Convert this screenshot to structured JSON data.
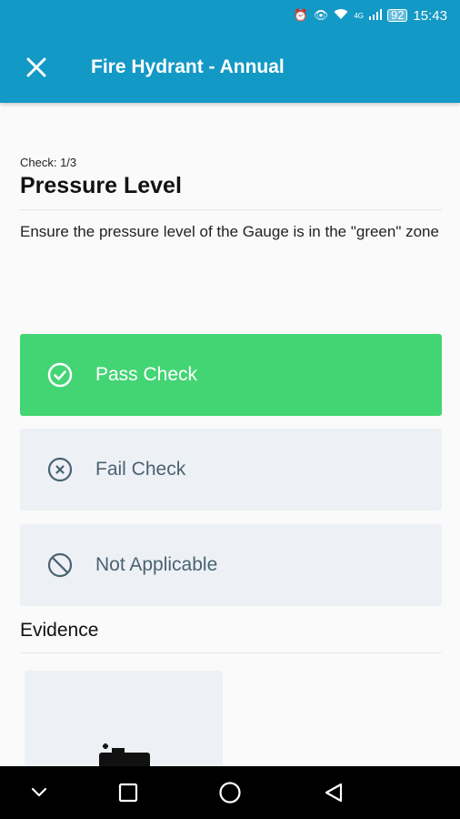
{
  "status_bar": {
    "battery": "92",
    "network": "4G",
    "time": "15:43"
  },
  "app_bar": {
    "title": "Fire Hydrant - Annual"
  },
  "check": {
    "counter": "Check: 1/3",
    "title": "Pressure Level",
    "description": "Ensure the pressure level of the Gauge is in the \"green\" zone"
  },
  "options": {
    "pass": "Pass Check",
    "fail": "Fail Check",
    "na": "Not Applicable"
  },
  "evidence": {
    "label": "Evidence"
  },
  "colors": {
    "primary": "#1399c5",
    "pass": "#43d574",
    "option_bg": "#edf1f5",
    "option_text": "#4a6272"
  }
}
